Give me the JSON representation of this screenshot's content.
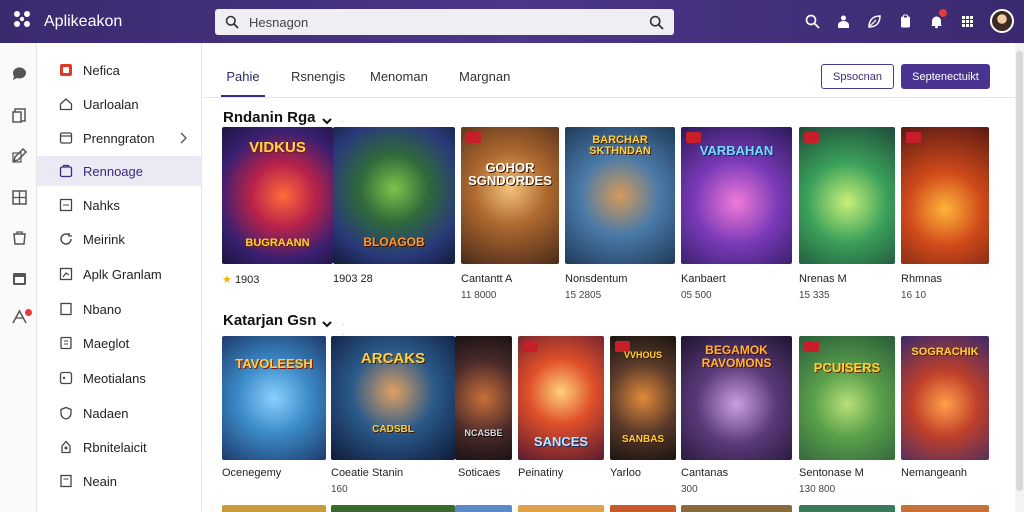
{
  "app": {
    "title": "Aplikeakon"
  },
  "search": {
    "placeholder": "Hesnagon"
  },
  "sidebar": {
    "items": [
      {
        "label": "Nefica",
        "icon": "store-icon",
        "active": false
      },
      {
        "label": "Uarloalan",
        "icon": "home-icon",
        "active": false
      },
      {
        "label": "Prenngraton",
        "icon": "folder-icon",
        "active": false,
        "has_chevron": true
      },
      {
        "label": "Rennoage",
        "icon": "apps-icon",
        "active": true
      },
      {
        "label": "Nahks",
        "icon": "page-icon",
        "active": false
      },
      {
        "label": "Meirink",
        "icon": "refresh-icon",
        "active": false
      },
      {
        "label": "Aplk Granlam",
        "icon": "chart-icon",
        "active": false
      },
      {
        "label": "Nbano",
        "icon": "document-icon",
        "active": false
      },
      {
        "label": "Maeglot",
        "icon": "tablet-icon",
        "active": false
      },
      {
        "label": "Meotialans",
        "icon": "gamepad-icon",
        "active": false
      },
      {
        "label": "Nadaen",
        "icon": "shield-icon",
        "active": false
      },
      {
        "label": "Rbnitelaicit",
        "icon": "user-icon",
        "active": false
      },
      {
        "label": "Neain",
        "icon": "note-icon",
        "active": false
      }
    ]
  },
  "tabs": [
    {
      "label": "Pahie",
      "active": true
    },
    {
      "label": "Rsnengis",
      "active": false
    },
    {
      "label": "Menoman",
      "active": false
    },
    {
      "label": "Margnan",
      "active": false
    }
  ],
  "buttons": {
    "outline": "Spsocnan",
    "primary": "Septenectuikt"
  },
  "sections": [
    {
      "title": "Rndanin Rga",
      "cards": [
        {
          "art": "VIDKUS / BUGRAANN",
          "name": "1903",
          "star": true,
          "sub": ""
        },
        {
          "art": "BLOAGOB",
          "name": "1903 28",
          "star": false,
          "sub": ""
        },
        {
          "art": "GOHOR SGNDORDES",
          "name": "Cantantt A",
          "star": false,
          "sub": "11 8000"
        },
        {
          "art": "BARCHAR SKTHNDAN",
          "name": "Nonsdentum",
          "star": false,
          "sub": "15 2805"
        },
        {
          "art": "VARBAHAN",
          "name": "Kanbaert",
          "star": false,
          "sub": "05 500"
        },
        {
          "art": "",
          "name": "Nrenas M",
          "star": false,
          "sub": "15 335"
        },
        {
          "art": "",
          "name": "Rhmnas",
          "star": false,
          "sub": "16 10"
        }
      ]
    },
    {
      "title": "Katarjan Gsn",
      "cards": [
        {
          "art": "TAVOLEESH",
          "name": "Ocenegemy",
          "star": false,
          "sub": ""
        },
        {
          "art": "ARCAKS / CADSBL",
          "name": "Coeatie Stanin",
          "star": false,
          "sub": "160"
        },
        {
          "art": "NCASBE",
          "name": "Soticaes",
          "star": false,
          "sub": ""
        },
        {
          "art": "SANCES",
          "name": "Peinatiny",
          "star": false,
          "sub": ""
        },
        {
          "art": "VVHOUS / SANBAS",
          "name": "Yarloo",
          "star": false,
          "sub": ""
        },
        {
          "art": "BEGAMOK RAVOMONS",
          "name": "Cantanas",
          "star": false,
          "sub": "300"
        },
        {
          "art": "PCUISERS",
          "name": "Sentonase M",
          "star": false,
          "sub": "130 800"
        },
        {
          "art": "SOGRACHIK",
          "name": "Nemangeanh",
          "star": false,
          "sub": ""
        }
      ]
    }
  ],
  "colors": {
    "topbar": "#3d2c74",
    "accent": "#4a3490",
    "active_bg": "#ebe9f4"
  }
}
